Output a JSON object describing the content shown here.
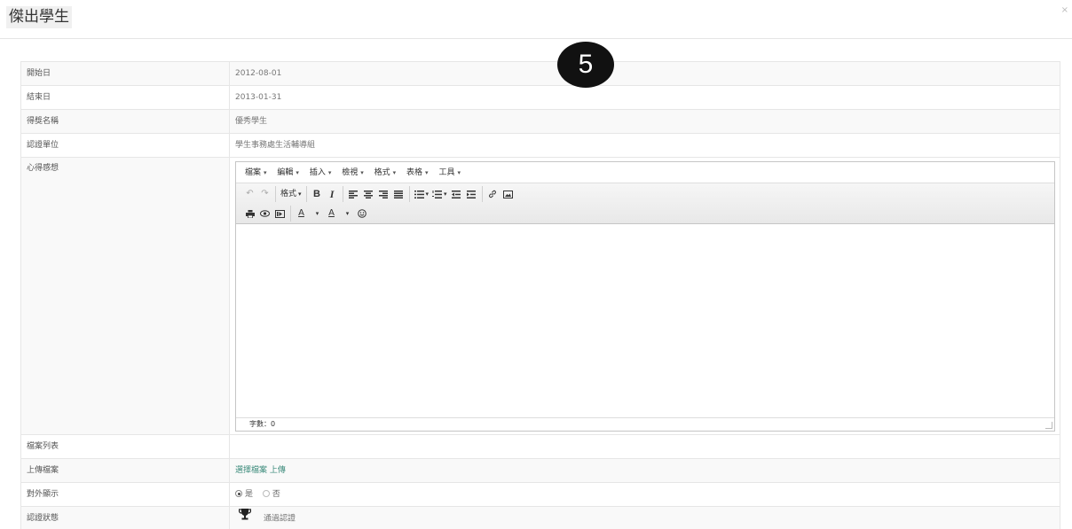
{
  "modal": {
    "title": "傑出學生",
    "close": "×"
  },
  "step_badge": "5",
  "rows": {
    "start_date": {
      "label": "開始日",
      "value": "2012-08-01"
    },
    "end_date": {
      "label": "結束日",
      "value": "2013-01-31"
    },
    "award_name": {
      "label": "得獎名稱",
      "value": "優秀學生"
    },
    "certifying_unit": {
      "label": "認證單位",
      "value": "學生事務處生活輔導組"
    },
    "reflection": {
      "label": "心得感想"
    },
    "file_list": {
      "label": "檔案列表",
      "value": ""
    },
    "upload": {
      "label": "上傳檔案",
      "link": "選擇檔案 上傳"
    },
    "public_display": {
      "label": "對外顯示",
      "yes": "是",
      "no": "否",
      "selected": "是"
    },
    "cert_status": {
      "label": "認證狀態",
      "value": "通過認證",
      "icon": "trophy-icon"
    }
  },
  "editor": {
    "menu": [
      "檔案",
      "編輯",
      "插入",
      "檢視",
      "格式",
      "表格",
      "工具"
    ],
    "format_label": "格式",
    "word_count": "字數：0"
  }
}
